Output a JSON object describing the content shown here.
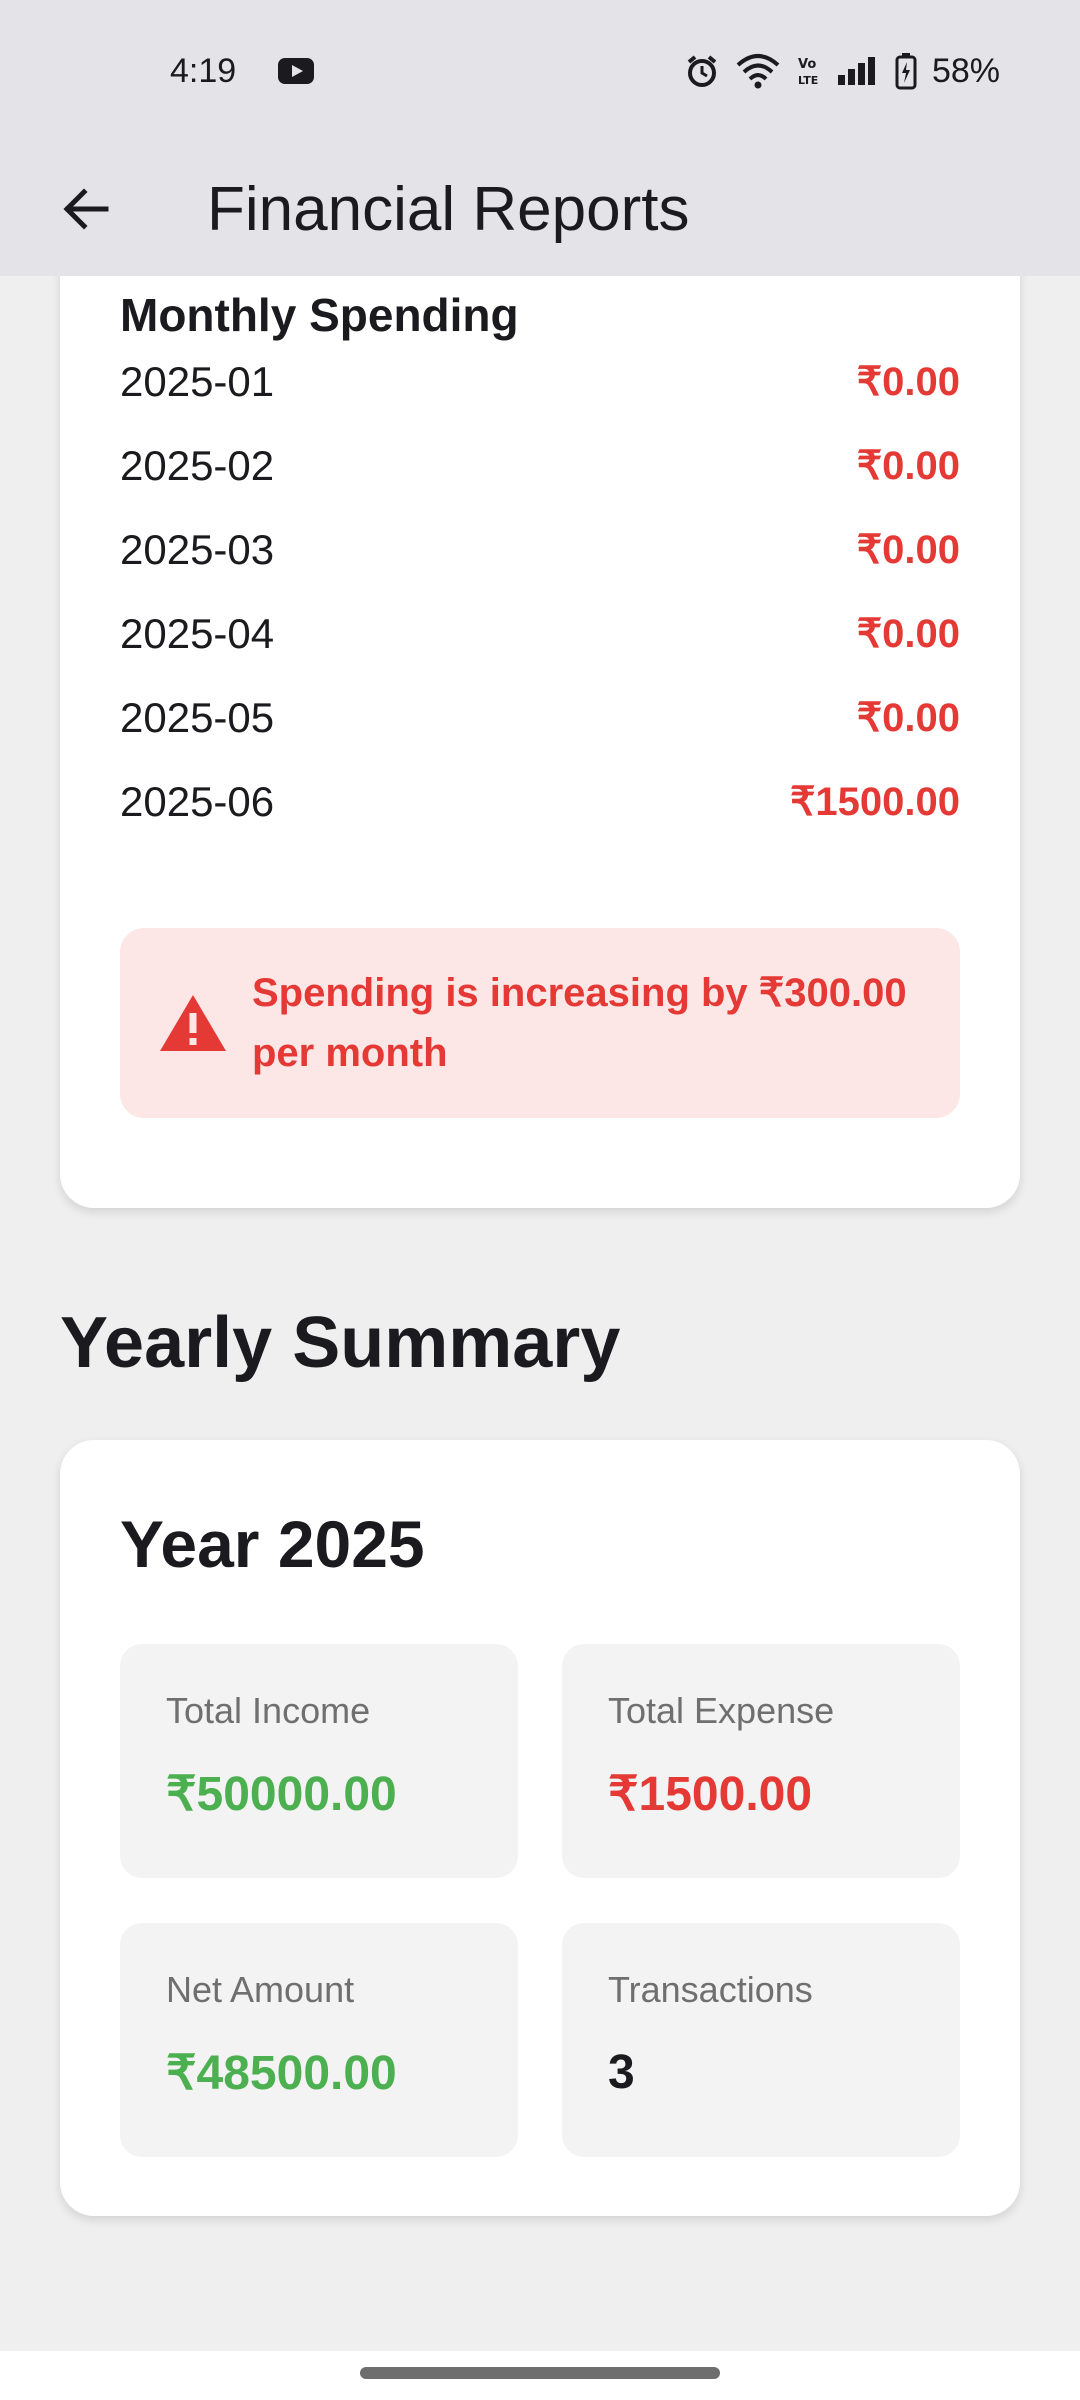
{
  "status_bar": {
    "time": "4:19",
    "battery": "58%",
    "volte": "Vo LTE",
    "icons": [
      "youtube-icon",
      "alarm-icon",
      "wifi-icon",
      "volte-icon",
      "signal-icon",
      "battery-icon"
    ]
  },
  "app_bar": {
    "title": "Financial Reports",
    "back_icon": "arrow-back-icon"
  },
  "monthly": {
    "heading": "Monthly Spending",
    "rows": [
      {
        "month": "2025-01",
        "amount": "₹0.00"
      },
      {
        "month": "2025-02",
        "amount": "₹0.00"
      },
      {
        "month": "2025-03",
        "amount": "₹0.00"
      },
      {
        "month": "2025-04",
        "amount": "₹0.00"
      },
      {
        "month": "2025-05",
        "amount": "₹0.00"
      },
      {
        "month": "2025-06",
        "amount": "₹1500.00"
      }
    ],
    "alert": {
      "icon": "warning-icon",
      "text": "Spending is increasing by ₹300.00 per month"
    }
  },
  "yearly": {
    "section_title": "Yearly Summary",
    "year_title": "Year 2025",
    "tiles": [
      {
        "label": "Total Income",
        "value": "₹50000.00",
        "color": "#4caf50"
      },
      {
        "label": "Total Expense",
        "value": "₹1500.00",
        "color": "#e53935"
      },
      {
        "label": "Net Amount",
        "value": "₹48500.00",
        "color": "#4caf50"
      },
      {
        "label": "Transactions",
        "value": "3",
        "color": "#1b1b1f"
      }
    ]
  },
  "colors": {
    "expense_red": "#e53935",
    "income_green": "#4caf50",
    "alert_bg": "#fde7e6",
    "app_bar_bg": "#e3e3e8",
    "page_bg": "#efefef"
  }
}
